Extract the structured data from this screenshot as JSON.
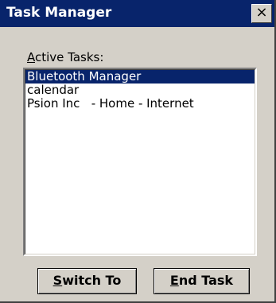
{
  "window": {
    "title": "Task Manager",
    "close_glyph": "×"
  },
  "label": {
    "accel": "A",
    "rest": "ctive Tasks:"
  },
  "tasks": [
    {
      "name": "Bluetooth Manager",
      "selected": true
    },
    {
      "name": "calendar",
      "selected": false
    },
    {
      "name": "Psion Inc   - Home - Internet",
      "selected": false
    }
  ],
  "buttons": {
    "switch_accel": "S",
    "switch_rest": "witch To",
    "end_accel": "E",
    "end_rest": "nd Task"
  },
  "colors": {
    "titlebar": "#08246b",
    "selection": "#08246b",
    "face": "#d4d0c8"
  }
}
